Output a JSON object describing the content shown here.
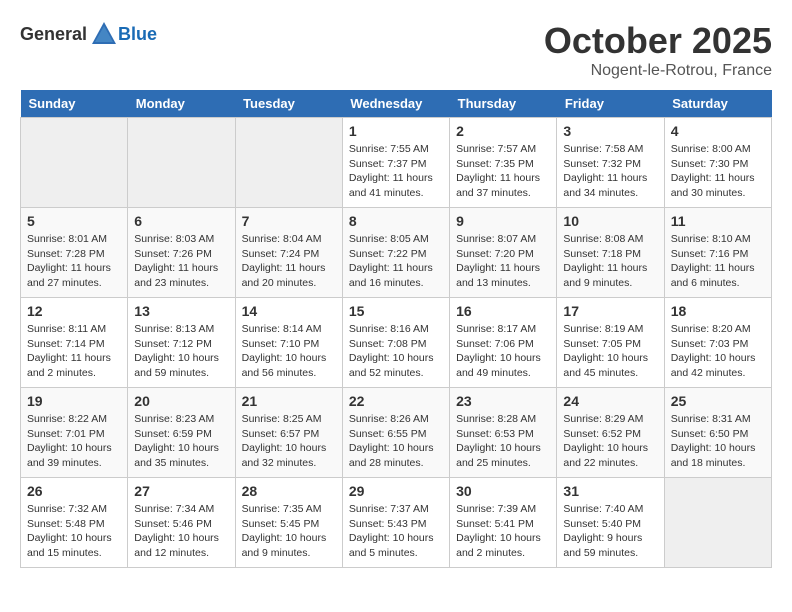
{
  "header": {
    "logo_general": "General",
    "logo_blue": "Blue",
    "month": "October 2025",
    "location": "Nogent-le-Rotrou, France"
  },
  "calendar": {
    "weekdays": [
      "Sunday",
      "Monday",
      "Tuesday",
      "Wednesday",
      "Thursday",
      "Friday",
      "Saturday"
    ],
    "weeks": [
      [
        {
          "day": "",
          "empty": true
        },
        {
          "day": "",
          "empty": true
        },
        {
          "day": "",
          "empty": true
        },
        {
          "day": "1",
          "sunrise": "Sunrise: 7:55 AM",
          "sunset": "Sunset: 7:37 PM",
          "daylight": "Daylight: 11 hours and 41 minutes."
        },
        {
          "day": "2",
          "sunrise": "Sunrise: 7:57 AM",
          "sunset": "Sunset: 7:35 PM",
          "daylight": "Daylight: 11 hours and 37 minutes."
        },
        {
          "day": "3",
          "sunrise": "Sunrise: 7:58 AM",
          "sunset": "Sunset: 7:32 PM",
          "daylight": "Daylight: 11 hours and 34 minutes."
        },
        {
          "day": "4",
          "sunrise": "Sunrise: 8:00 AM",
          "sunset": "Sunset: 7:30 PM",
          "daylight": "Daylight: 11 hours and 30 minutes."
        }
      ],
      [
        {
          "day": "5",
          "sunrise": "Sunrise: 8:01 AM",
          "sunset": "Sunset: 7:28 PM",
          "daylight": "Daylight: 11 hours and 27 minutes."
        },
        {
          "day": "6",
          "sunrise": "Sunrise: 8:03 AM",
          "sunset": "Sunset: 7:26 PM",
          "daylight": "Daylight: 11 hours and 23 minutes."
        },
        {
          "day": "7",
          "sunrise": "Sunrise: 8:04 AM",
          "sunset": "Sunset: 7:24 PM",
          "daylight": "Daylight: 11 hours and 20 minutes."
        },
        {
          "day": "8",
          "sunrise": "Sunrise: 8:05 AM",
          "sunset": "Sunset: 7:22 PM",
          "daylight": "Daylight: 11 hours and 16 minutes."
        },
        {
          "day": "9",
          "sunrise": "Sunrise: 8:07 AM",
          "sunset": "Sunset: 7:20 PM",
          "daylight": "Daylight: 11 hours and 13 minutes."
        },
        {
          "day": "10",
          "sunrise": "Sunrise: 8:08 AM",
          "sunset": "Sunset: 7:18 PM",
          "daylight": "Daylight: 11 hours and 9 minutes."
        },
        {
          "day": "11",
          "sunrise": "Sunrise: 8:10 AM",
          "sunset": "Sunset: 7:16 PM",
          "daylight": "Daylight: 11 hours and 6 minutes."
        }
      ],
      [
        {
          "day": "12",
          "sunrise": "Sunrise: 8:11 AM",
          "sunset": "Sunset: 7:14 PM",
          "daylight": "Daylight: 11 hours and 2 minutes."
        },
        {
          "day": "13",
          "sunrise": "Sunrise: 8:13 AM",
          "sunset": "Sunset: 7:12 PM",
          "daylight": "Daylight: 10 hours and 59 minutes."
        },
        {
          "day": "14",
          "sunrise": "Sunrise: 8:14 AM",
          "sunset": "Sunset: 7:10 PM",
          "daylight": "Daylight: 10 hours and 56 minutes."
        },
        {
          "day": "15",
          "sunrise": "Sunrise: 8:16 AM",
          "sunset": "Sunset: 7:08 PM",
          "daylight": "Daylight: 10 hours and 52 minutes."
        },
        {
          "day": "16",
          "sunrise": "Sunrise: 8:17 AM",
          "sunset": "Sunset: 7:06 PM",
          "daylight": "Daylight: 10 hours and 49 minutes."
        },
        {
          "day": "17",
          "sunrise": "Sunrise: 8:19 AM",
          "sunset": "Sunset: 7:05 PM",
          "daylight": "Daylight: 10 hours and 45 minutes."
        },
        {
          "day": "18",
          "sunrise": "Sunrise: 8:20 AM",
          "sunset": "Sunset: 7:03 PM",
          "daylight": "Daylight: 10 hours and 42 minutes."
        }
      ],
      [
        {
          "day": "19",
          "sunrise": "Sunrise: 8:22 AM",
          "sunset": "Sunset: 7:01 PM",
          "daylight": "Daylight: 10 hours and 39 minutes."
        },
        {
          "day": "20",
          "sunrise": "Sunrise: 8:23 AM",
          "sunset": "Sunset: 6:59 PM",
          "daylight": "Daylight: 10 hours and 35 minutes."
        },
        {
          "day": "21",
          "sunrise": "Sunrise: 8:25 AM",
          "sunset": "Sunset: 6:57 PM",
          "daylight": "Daylight: 10 hours and 32 minutes."
        },
        {
          "day": "22",
          "sunrise": "Sunrise: 8:26 AM",
          "sunset": "Sunset: 6:55 PM",
          "daylight": "Daylight: 10 hours and 28 minutes."
        },
        {
          "day": "23",
          "sunrise": "Sunrise: 8:28 AM",
          "sunset": "Sunset: 6:53 PM",
          "daylight": "Daylight: 10 hours and 25 minutes."
        },
        {
          "day": "24",
          "sunrise": "Sunrise: 8:29 AM",
          "sunset": "Sunset: 6:52 PM",
          "daylight": "Daylight: 10 hours and 22 minutes."
        },
        {
          "day": "25",
          "sunrise": "Sunrise: 8:31 AM",
          "sunset": "Sunset: 6:50 PM",
          "daylight": "Daylight: 10 hours and 18 minutes."
        }
      ],
      [
        {
          "day": "26",
          "sunrise": "Sunrise: 7:32 AM",
          "sunset": "Sunset: 5:48 PM",
          "daylight": "Daylight: 10 hours and 15 minutes."
        },
        {
          "day": "27",
          "sunrise": "Sunrise: 7:34 AM",
          "sunset": "Sunset: 5:46 PM",
          "daylight": "Daylight: 10 hours and 12 minutes."
        },
        {
          "day": "28",
          "sunrise": "Sunrise: 7:35 AM",
          "sunset": "Sunset: 5:45 PM",
          "daylight": "Daylight: 10 hours and 9 minutes."
        },
        {
          "day": "29",
          "sunrise": "Sunrise: 7:37 AM",
          "sunset": "Sunset: 5:43 PM",
          "daylight": "Daylight: 10 hours and 5 minutes."
        },
        {
          "day": "30",
          "sunrise": "Sunrise: 7:39 AM",
          "sunset": "Sunset: 5:41 PM",
          "daylight": "Daylight: 10 hours and 2 minutes."
        },
        {
          "day": "31",
          "sunrise": "Sunrise: 7:40 AM",
          "sunset": "Sunset: 5:40 PM",
          "daylight": "Daylight: 9 hours and 59 minutes."
        },
        {
          "day": "",
          "empty": true
        }
      ]
    ]
  }
}
